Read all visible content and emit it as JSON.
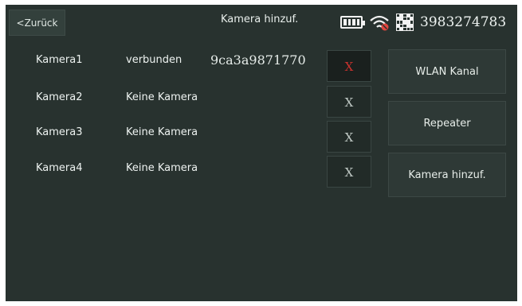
{
  "header": {
    "back_label": "<Zurück",
    "title": "Kamera hinzuf.",
    "device_id": "3983274783",
    "icons": [
      "battery-icon",
      "wifi-warning-icon",
      "qr-code-icon"
    ],
    "wifi_warning_color": "#e2473f"
  },
  "cameras": [
    {
      "name": "Kamera1",
      "status": "verbunden",
      "id": "9ca3a9871770",
      "delete_label": "X",
      "selected": true
    },
    {
      "name": "Kamera2",
      "status": "Keine Kamera",
      "id": "",
      "delete_label": "X",
      "selected": false
    },
    {
      "name": "Kamera3",
      "status": "Keine Kamera",
      "id": "",
      "delete_label": "X",
      "selected": false
    },
    {
      "name": "Kamera4",
      "status": "Keine Kamera",
      "id": "",
      "delete_label": "X",
      "selected": false
    }
  ],
  "side_buttons": {
    "wlan": "WLAN Kanal",
    "repeater": "Repeater",
    "add_camera": "Kamera hinzuf."
  }
}
